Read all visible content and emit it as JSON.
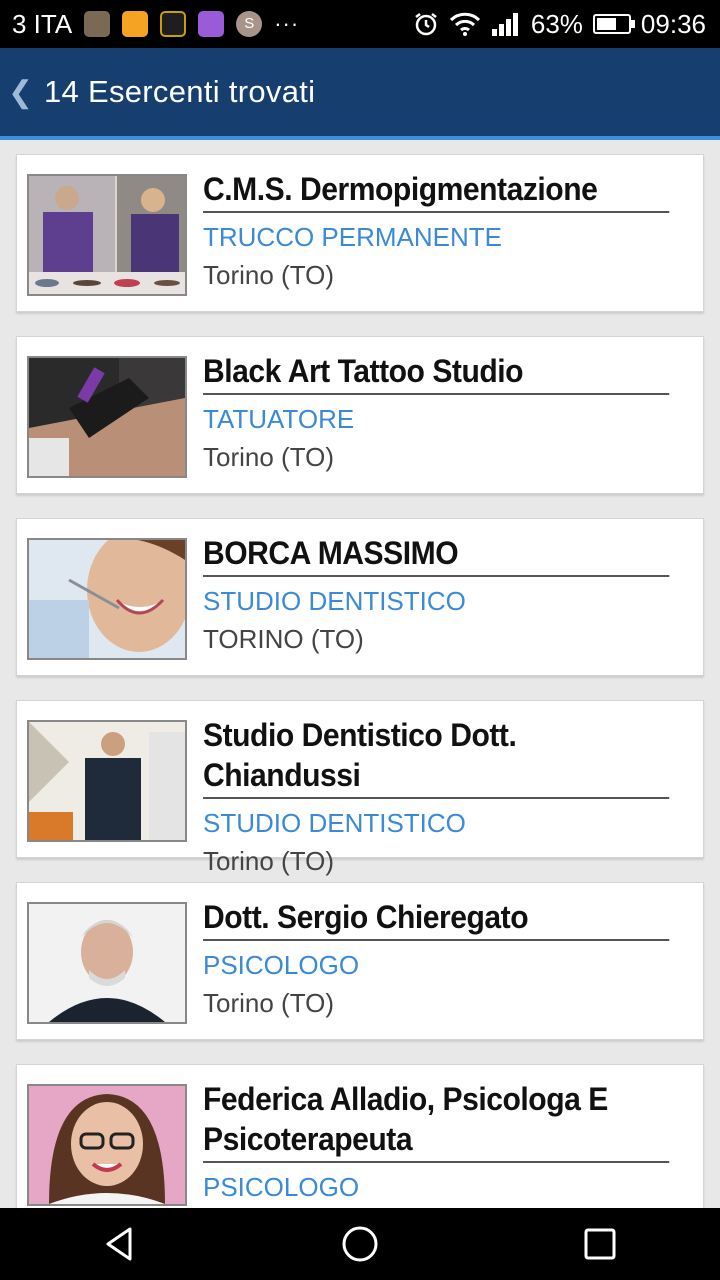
{
  "status_bar": {
    "carrier": "3 ITA",
    "more": "···",
    "s_badge": "S",
    "battery_percent": "63%",
    "battery_level": 0.63,
    "time": "09:36"
  },
  "header": {
    "back_icon": "chevron-left-icon",
    "title": "14 Esercenti trovati"
  },
  "results": [
    {
      "name": "C.M.S. Dermopigmentazione",
      "category": "TRUCCO PERMANENTE",
      "city": "Torino (TO)"
    },
    {
      "name": "Black Art Tattoo Studio",
      "category": "TATUATORE",
      "city": "Torino (TO)"
    },
    {
      "name": "BORCA MASSIMO",
      "category": "STUDIO DENTISTICO",
      "city": "TORINO (TO)"
    },
    {
      "name": "Studio Dentistico Dott. Chiandussi",
      "category": "STUDIO DENTISTICO",
      "city": "Torino (TO)"
    },
    {
      "name": "Dott. Sergio Chieregato",
      "category": "PSICOLOGO",
      "city": "Torino (TO)"
    },
    {
      "name": "Federica Alladio, Psicologa E Psicoterapeuta",
      "category": "PSICOLOGO",
      "city": ""
    }
  ],
  "colors": {
    "app_bar": "#163f6f",
    "accent_line": "#3a8fe0",
    "category_text": "#3a8ad8",
    "background": "#e8e8e8"
  },
  "nav_bar": {
    "back": "triangle-back-icon",
    "home": "circle-home-icon",
    "recents": "square-recents-icon"
  }
}
